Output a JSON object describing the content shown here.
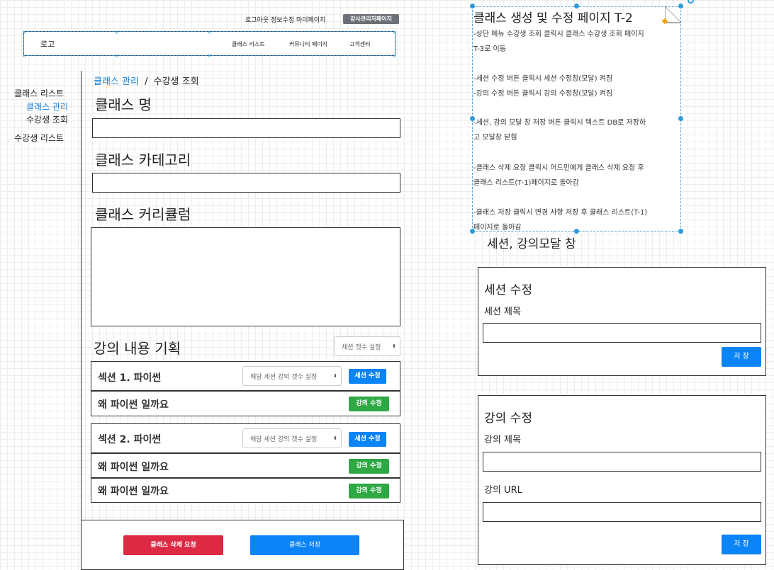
{
  "topnav": {
    "links": "로그아웃  정보수정  마이페이지",
    "admin_badge": "강사관리자페이지",
    "logo": "로고",
    "menu": [
      "클래스 리스트",
      "커뮤니티 페이지",
      "고객센터"
    ]
  },
  "sidebar": {
    "class_list": "클래스 리스트",
    "class_manage": "클래스 관리",
    "student_view": "수강생 조회",
    "student_list": "수강생 리스트"
  },
  "breadcrumb": {
    "link": "클래스 관리",
    "sep": "/",
    "current": "수강생 조회"
  },
  "form": {
    "class_name_label": "클래스 명",
    "class_category_label": "클래스 카테고리",
    "class_curriculum_label": "클래스 커리큘럼",
    "lecture_plan_label": "강의 내용 기획",
    "session_count_select": "세션 갯수 설정"
  },
  "sessions": [
    {
      "title": "섹션 1. 파이썬",
      "count_select": "해당 세션 강의 갯수 설정",
      "edit_label": "세션 수정",
      "lectures": [
        {
          "title": "왜 파이썬 일까요",
          "edit_label": "강의 수정"
        }
      ]
    },
    {
      "title": "섹션 2. 파이썬",
      "count_select": "해당 세션 강의 갯수 설정",
      "edit_label": "세션 수정",
      "lectures": [
        {
          "title": "왜 파이썬 일까요",
          "edit_label": "강의 수정"
        },
        {
          "title": "왜 파이썬 일까요",
          "edit_label": "강의 수정"
        }
      ]
    }
  ],
  "footer": {
    "delete_label": "클래스 삭제 요청",
    "save_label": "클래스 저장"
  },
  "note": {
    "title": "클래스 생성 및 수정 페이지 T-2",
    "lines": [
      "-상단 메뉴 수강생 조회 클릭시 클래스 수강생 조회 페이지",
      "T-3로 이동",
      "-세션 수정 버튼 클릭시 세션 수정창(모달) 켜짐",
      "-강의 수정 버튼 클릭시 강의 수정창(모달) 켜짐",
      "-세션, 강의 모달 창 저장 버튼 클릭시 텍스트 DB로 저장하",
      "고 모달창 닫힘",
      "-클래스 삭제 요청 클릭시 어드민에게 클래스 삭제 요청 후",
      "클래스 리스트(T-1)페이지로 돌아감",
      "-클래스 저장 클릭시 변경 사항 저장 후 클래스 리스트(T-1)",
      "페이지로 돌아감"
    ]
  },
  "modal_caption": "세션, 강의모달 창",
  "session_modal": {
    "title": "세션 수정",
    "field_label": "세션 제목",
    "save_label": "저 장"
  },
  "lecture_modal": {
    "title": "강의 수정",
    "title_label": "강의 제목",
    "url_label": "강의 URL",
    "save_label": "저 장"
  },
  "colors": {
    "link": "#1a7fd4",
    "primary": "#0a84f6",
    "success": "#2ea843",
    "danger": "#dc2a45",
    "badge": "#6b7077"
  }
}
